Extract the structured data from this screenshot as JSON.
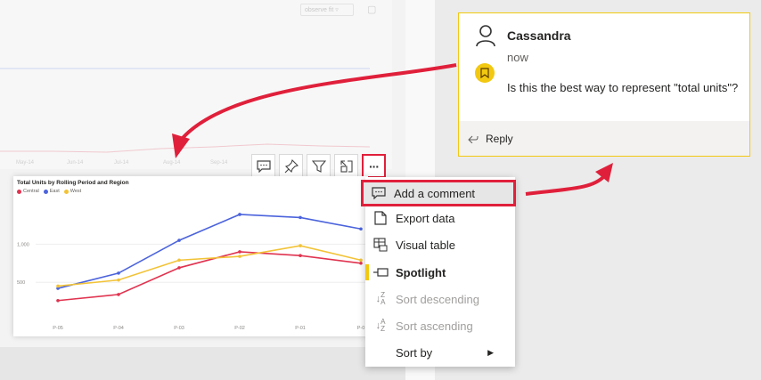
{
  "background": {
    "top_pill_text": "observe fit ▿",
    "x_ticks": [
      "May-14",
      "Jun-14",
      "Jul-14",
      "Aug-14",
      "Sep-14"
    ]
  },
  "toolbar": {
    "comment_icon": "comment-icon",
    "pin_icon": "pin-icon",
    "filter_icon": "filter-icon",
    "focus_icon": "focus-mode-icon",
    "more_label": "···"
  },
  "visual": {
    "title": "Total Units by Rolling Period and Region",
    "legend": [
      {
        "label": "Central",
        "color": "#e0334f"
      },
      {
        "label": "East",
        "color": "#4b63dc"
      },
      {
        "label": "West",
        "color": "#f2c337"
      }
    ]
  },
  "chart_data": {
    "type": "line",
    "title": "Total Units by Rolling Period and Region",
    "categories": [
      "P-05",
      "P-04",
      "P-03",
      "P-02",
      "P-01",
      "P-0"
    ],
    "series": [
      {
        "name": "Central",
        "color": "#e0334f",
        "values": [
          260,
          340,
          690,
          900,
          850,
          750
        ]
      },
      {
        "name": "East",
        "color": "#4b63dc",
        "values": [
          420,
          620,
          1050,
          1390,
          1350,
          1200
        ]
      },
      {
        "name": "West",
        "color": "#f2c337",
        "values": [
          450,
          530,
          790,
          840,
          980,
          790
        ]
      }
    ],
    "y_ticks": [
      "1,000",
      "500"
    ],
    "y_tick_values": [
      1000,
      500
    ],
    "ylim": [
      0,
      1600
    ]
  },
  "menu": {
    "items": [
      {
        "label": "Add a comment",
        "icon": "comment-icon"
      },
      {
        "label": "Export data",
        "icon": "export-icon"
      },
      {
        "label": "Visual table",
        "icon": "table-icon"
      },
      {
        "label": "Spotlight",
        "icon": "spotlight-icon"
      },
      {
        "label": "Sort descending",
        "icon": "sort-descending-icon"
      },
      {
        "label": "Sort ascending",
        "icon": "sort-ascending-icon"
      },
      {
        "label": "Sort by",
        "icon": ""
      }
    ],
    "submenu_chevron": "▶"
  },
  "comment": {
    "author": "Cassandra",
    "time": "now",
    "text": "Is this the best way to represent \"total units\"?",
    "reply_label": "Reply",
    "reply_icon": "reply-icon",
    "avatar_icon": "person-icon",
    "badge_icon": "bookmark-icon"
  },
  "colors": {
    "accent": "#f2c811",
    "highlight": "#e0203b"
  }
}
